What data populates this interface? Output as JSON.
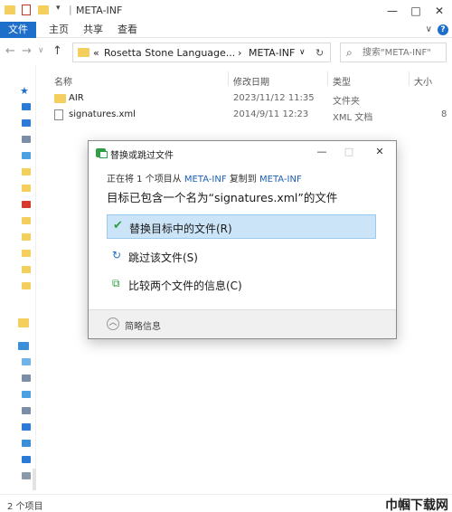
{
  "window": {
    "title": "META-INF",
    "minimize_glyph": "—",
    "maximize_glyph": "□",
    "close_glyph": "✕"
  },
  "ribbon": {
    "tabs": [
      {
        "label": "文件",
        "active": true
      },
      {
        "label": "主页",
        "active": false
      },
      {
        "label": "共享",
        "active": false
      },
      {
        "label": "查看",
        "active": false
      }
    ],
    "expand_glyph": "∨",
    "help_glyph": "?"
  },
  "address": {
    "back_glyph": "←",
    "forward_glyph": "→",
    "recent_glyph": "∨",
    "up_glyph": "↑",
    "overflow_glyph": "«",
    "parent_segment": "Rosetta Stone Language...",
    "separator": "›",
    "current_segment": "META-INF",
    "dropdown_glyph": "∨",
    "refresh_glyph": "↻"
  },
  "search": {
    "placeholder": "搜索\"META-INF\"",
    "icon": "search-icon"
  },
  "columns": {
    "name": "名称",
    "date": "修改日期",
    "type": "类型",
    "size": "大小"
  },
  "files": [
    {
      "name": "AIR",
      "date": "2023/11/12 11:35",
      "type": "文件夹",
      "size": "",
      "icon": "folder-icon"
    },
    {
      "name": "signatures.xml",
      "date": "2014/9/11 12:23",
      "type": "XML 文档",
      "size": "8",
      "icon": "xml-file-icon"
    }
  ],
  "status": {
    "count": "2 个项目"
  },
  "watermark": "巾帼下载网",
  "dialog": {
    "title": "替换或跳过文件",
    "line_prefix": "正在将 1 个项目从",
    "source": "META-INF",
    "line_middle": "复制到",
    "destination": "META-INF",
    "heading": "目标已包含一个名为“signatures.xml”的文件",
    "options": [
      {
        "label": "替换目标中的文件(R)",
        "selected": true,
        "icon": "check-icon",
        "glyph": "✔"
      },
      {
        "label": "跳过该文件(S)",
        "selected": false,
        "icon": "skip-icon",
        "glyph": "↻"
      },
      {
        "label": "比较两个文件的信息(C)",
        "selected": false,
        "icon": "compare-icon",
        "glyph": "⧉"
      }
    ],
    "more_info": "简略信息",
    "more_info_glyph": "︿",
    "minimize_glyph": "—",
    "maximize_glyph": "□",
    "close_glyph": "✕"
  },
  "colors": {
    "accent": "#1e6fc9",
    "folder": "#f5cf5e",
    "selection": "#cce4f7",
    "link": "#1e5fb4",
    "check": "#2f9e44"
  }
}
